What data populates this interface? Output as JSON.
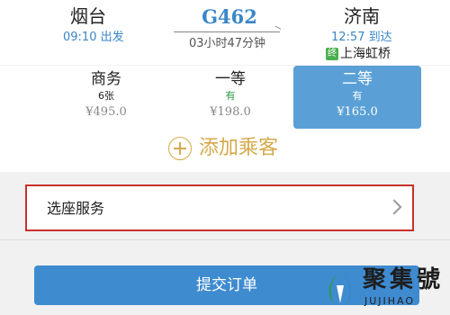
{
  "trip": {
    "from_station": "烟台",
    "to_station": "济南",
    "train_no": "G462",
    "dep_time": "09:10 出发",
    "arr_time": "12:57 到达",
    "duration": "03小时47分钟",
    "via_badge": "终",
    "via_station": "上海虹桥"
  },
  "seats": [
    {
      "name": "商务",
      "availability": "6张",
      "price": "¥495.0",
      "selected": false
    },
    {
      "name": "一等",
      "availability": "有",
      "price": "¥198.0",
      "selected": false
    },
    {
      "name": "二等",
      "availability": "有",
      "price": "¥165.0",
      "selected": true
    }
  ],
  "add_passenger_label": "添加乘客",
  "seat_service_label": "选座服务",
  "submit_label": "提交订单",
  "watermark": {
    "title": "聚集號",
    "subtitle": "JUJIHAO"
  },
  "colors": {
    "accent_blue": "#3f8bd0",
    "selected_seat": "#5aa0d6",
    "add_gold": "#d5a94a",
    "highlight_red": "#c9302c",
    "green": "#2e9a4a"
  }
}
